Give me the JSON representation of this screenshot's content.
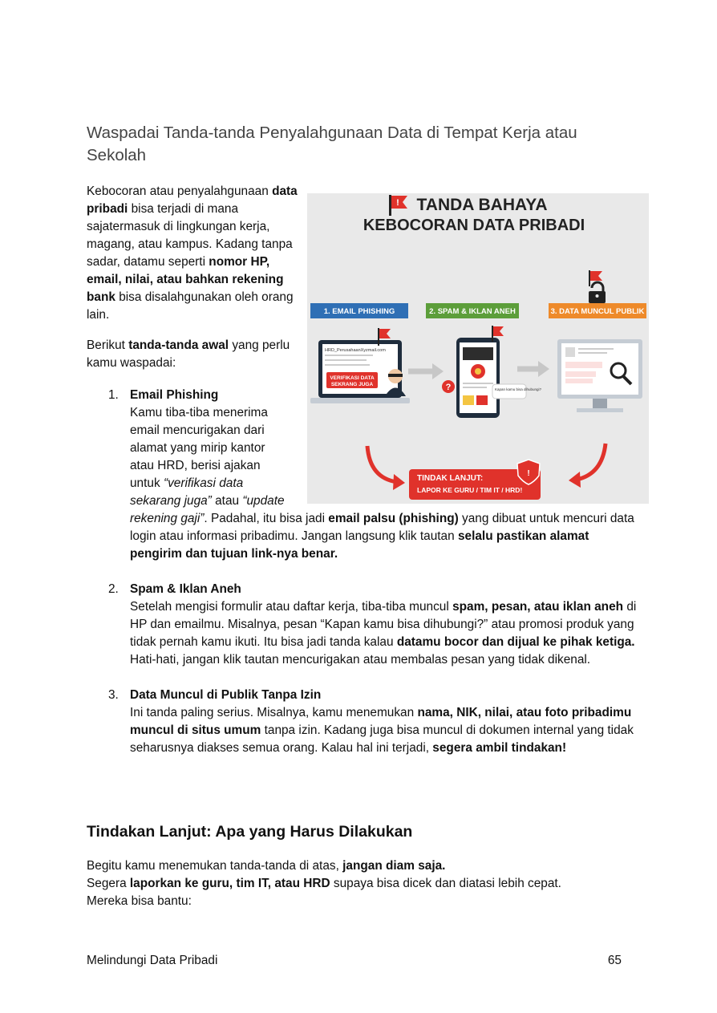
{
  "heading": "Waspadai Tanda-tanda Penyalahgunaan Data di Tempat Kerja atau Sekolah",
  "intro": {
    "t1": "Kebocoran atau penyalahgunaan ",
    "b1": "data pribadi",
    "t2": " bisa terjadi di mana sajatermasuk di lingkungan kerja, magang, atau kampus. Kadang tanpa sadar, datamu seperti ",
    "b2": "nomor HP, email, nilai, atau bahkan rekening bank",
    "t3": " bisa disalahgunakan oleh orang lain."
  },
  "intro2": {
    "t1": "Berikut ",
    "b1": "tanda-tanda awal",
    "t2": " yang perlu kamu waspadai:"
  },
  "items": [
    {
      "num": "1.",
      "title": "Email Phishing",
      "t1": "Kamu tiba-tiba menerima email mencurigakan dari alamat yang mirip kantor atau HRD, berisi ajakan untuk ",
      "i1": "“verifikasi data sekarang juga”",
      "t2": " atau ",
      "i2": "“update rekening gaji”",
      "t3": ". Padahal, itu bisa jadi ",
      "b1": "email palsu (phishing)",
      "t4": " yang dibuat untuk mencuri data login atau informasi pribadimu. Jangan langsung klik tautan  ",
      "b2": "selalu pastikan alamat pengirim dan tujuan link-nya benar."
    },
    {
      "num": "2.",
      "title": "Spam & Iklan Aneh",
      "t1": "Setelah mengisi formulir atau daftar kerja, tiba-tiba muncul ",
      "b1": "spam, pesan, atau iklan aneh",
      "t2": " di HP dan emailmu. Misalnya, pesan “Kapan kamu bisa dihubungi?” atau promosi produk yang tidak pernah kamu ikuti. Itu bisa jadi tanda kalau ",
      "b2": "datamu bocor dan dijual ke pihak ketiga.",
      "t3": " Hati-hati, jangan klik tautan mencurigakan atau membalas pesan yang tidak dikenal."
    },
    {
      "num": "3.",
      "title": "Data Muncul di Publik Tanpa Izin",
      "t1": "Ini tanda paling serius. Misalnya, kamu menemukan ",
      "b1": "nama, NIK, nilai, atau foto pribadimu muncul di situs umum",
      "t2": " tanpa izin. Kadang juga bisa muncul di dokumen internal yang tidak seharusnya diakses semua orang. Kalau hal ini terjadi, ",
      "b2": "segera ambil tindakan!"
    }
  ],
  "heading2": "Tindakan Lanjut: Apa yang Harus Dilakukan",
  "closing": {
    "t1": "Begitu kamu menemukan tanda-tanda di atas, ",
    "b1": "jangan diam saja.",
    "t2": " Segera ",
    "b2": "laporkan ke guru, tim IT, atau HRD",
    "t3": " supaya bisa dicek dan diatasi lebih cepat.",
    "t4": "Mereka bisa bantu:"
  },
  "infographic": {
    "title1": "TANDA BAHAYA",
    "title2": "KEBOCORAN DATA PRIBADI",
    "label1": "1. EMAIL PHISHING",
    "label2": "2. SPAM & IKLAN ANEH",
    "label3": "3. DATA MUNCUL PUBLIK",
    "email_addr": "HRD_PerusahaanXyzmail.com",
    "verif1": "VERIFIKASI DATA",
    "verif2": "SEKRANG JUGA",
    "phone_msg": "Kapan kamu bisa dihubungi?",
    "action1": "TINDAK LANJUT:",
    "action2": "LAPOR KE GURU / TIM IT / HRD!",
    "colors": {
      "red": "#e0322b",
      "blue": "#2f6fb5",
      "green": "#5c9e3a",
      "orange": "#ee8a2a",
      "bg": "#e9e9e9"
    }
  },
  "footer": {
    "left": "Melindungi Data Pribadi",
    "right": "65"
  }
}
